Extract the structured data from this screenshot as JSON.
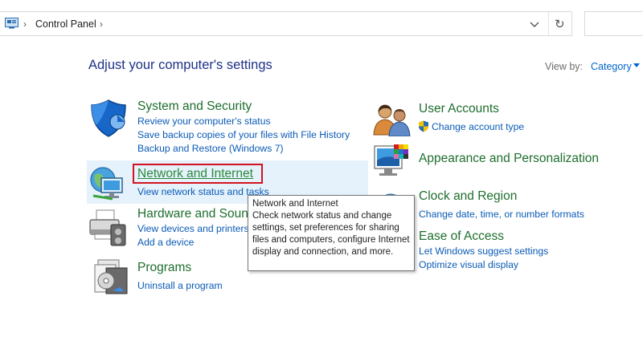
{
  "address_bar": {
    "location": "Control Panel"
  },
  "header": {
    "title": "Adjust your computer's settings",
    "view_by_label": "View by:",
    "view_by_value": "Category"
  },
  "categories": {
    "system_security": {
      "title": "System and Security",
      "links": [
        "Review your computer's status",
        "Save backup copies of your files with File History",
        "Backup and Restore (Windows 7)"
      ]
    },
    "network_internet": {
      "title": "Network and Internet",
      "links": [
        "View network status and tasks"
      ]
    },
    "hardware_sound": {
      "title": "Hardware and Sound",
      "links": [
        "View devices and printers",
        "Add a device"
      ]
    },
    "programs": {
      "title": "Programs",
      "links": [
        "Uninstall a program"
      ]
    },
    "user_accounts": {
      "title": "User Accounts",
      "links": [
        "Change account type"
      ]
    },
    "appearance": {
      "title": "Appearance and Personalization"
    },
    "clock_region": {
      "title": "Clock and Region",
      "links": [
        "Change date, time, or number formats"
      ]
    },
    "ease_access": {
      "title": "Ease of Access",
      "links": [
        "Let Windows suggest settings",
        "Optimize visual display"
      ]
    }
  },
  "tooltip": {
    "title": "Network and Internet",
    "body": "Check network status and change settings, set preferences for sharing files and computers, configure Internet display and connection, and more."
  },
  "colors": {
    "category_title": "#1e6e2e",
    "link": "#0a5bb5",
    "page_title": "#1e3287",
    "hover_background": "#e5f1fb",
    "focus_border": "#d3131f"
  }
}
